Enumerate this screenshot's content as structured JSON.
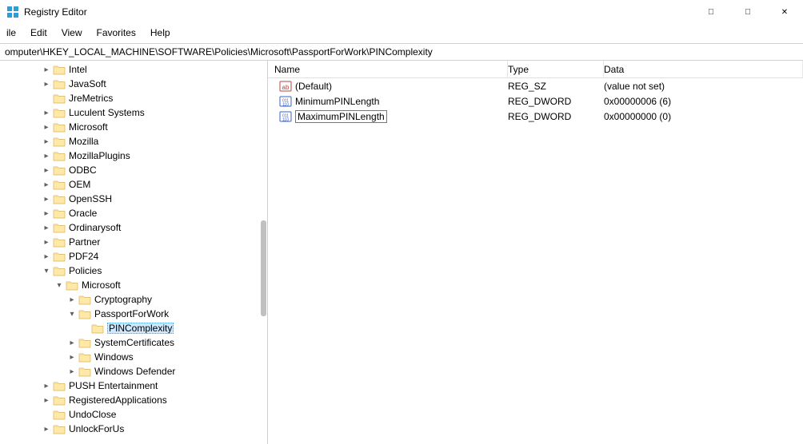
{
  "window": {
    "title": "Registry Editor"
  },
  "menu": {
    "items": [
      "ile",
      "Edit",
      "View",
      "Favorites",
      "Help"
    ]
  },
  "address": {
    "path": "omputer\\HKEY_LOCAL_MACHINE\\SOFTWARE\\Policies\\Microsoft\\PassportForWork\\PINComplexity"
  },
  "tree": {
    "nodes": [
      {
        "indent": 3,
        "expander": "right",
        "label": "Intel"
      },
      {
        "indent": 3,
        "expander": "right",
        "label": "JavaSoft"
      },
      {
        "indent": 3,
        "expander": "none",
        "label": "JreMetrics"
      },
      {
        "indent": 3,
        "expander": "right",
        "label": "Luculent Systems"
      },
      {
        "indent": 3,
        "expander": "right",
        "label": "Microsoft"
      },
      {
        "indent": 3,
        "expander": "right",
        "label": "Mozilla"
      },
      {
        "indent": 3,
        "expander": "right",
        "label": "MozillaPlugins"
      },
      {
        "indent": 3,
        "expander": "right",
        "label": "ODBC"
      },
      {
        "indent": 3,
        "expander": "right",
        "label": "OEM"
      },
      {
        "indent": 3,
        "expander": "right",
        "label": "OpenSSH"
      },
      {
        "indent": 3,
        "expander": "right",
        "label": "Oracle"
      },
      {
        "indent": 3,
        "expander": "right",
        "label": "Ordinarysoft"
      },
      {
        "indent": 3,
        "expander": "right",
        "label": "Partner"
      },
      {
        "indent": 3,
        "expander": "right",
        "label": "PDF24"
      },
      {
        "indent": 3,
        "expander": "down",
        "label": "Policies"
      },
      {
        "indent": 4,
        "expander": "down",
        "label": "Microsoft"
      },
      {
        "indent": 5,
        "expander": "right",
        "label": "Cryptography"
      },
      {
        "indent": 5,
        "expander": "down",
        "label": "PassportForWork"
      },
      {
        "indent": 6,
        "expander": "none",
        "label": "PINComplexity",
        "selected": true
      },
      {
        "indent": 5,
        "expander": "right",
        "label": "SystemCertificates"
      },
      {
        "indent": 5,
        "expander": "right",
        "label": "Windows"
      },
      {
        "indent": 5,
        "expander": "right",
        "label": "Windows Defender"
      },
      {
        "indent": 3,
        "expander": "right",
        "label": "PUSH Entertainment"
      },
      {
        "indent": 3,
        "expander": "right",
        "label": "RegisteredApplications"
      },
      {
        "indent": 3,
        "expander": "none",
        "label": "UndoClose"
      },
      {
        "indent": 3,
        "expander": "right",
        "label": "UnlockForUs"
      }
    ]
  },
  "list": {
    "columns": {
      "name": "Name",
      "type": "Type",
      "data": "Data"
    },
    "rows": [
      {
        "icon": "string",
        "name": "(Default)",
        "type": "REG_SZ",
        "data": "(value not set)",
        "editing": false
      },
      {
        "icon": "binary",
        "name": "MinimumPINLength",
        "type": "REG_DWORD",
        "data": "0x00000006 (6)",
        "editing": false
      },
      {
        "icon": "binary",
        "name": "MaximumPINLength",
        "type": "REG_DWORD",
        "data": "0x00000000 (0)",
        "editing": true
      }
    ]
  }
}
